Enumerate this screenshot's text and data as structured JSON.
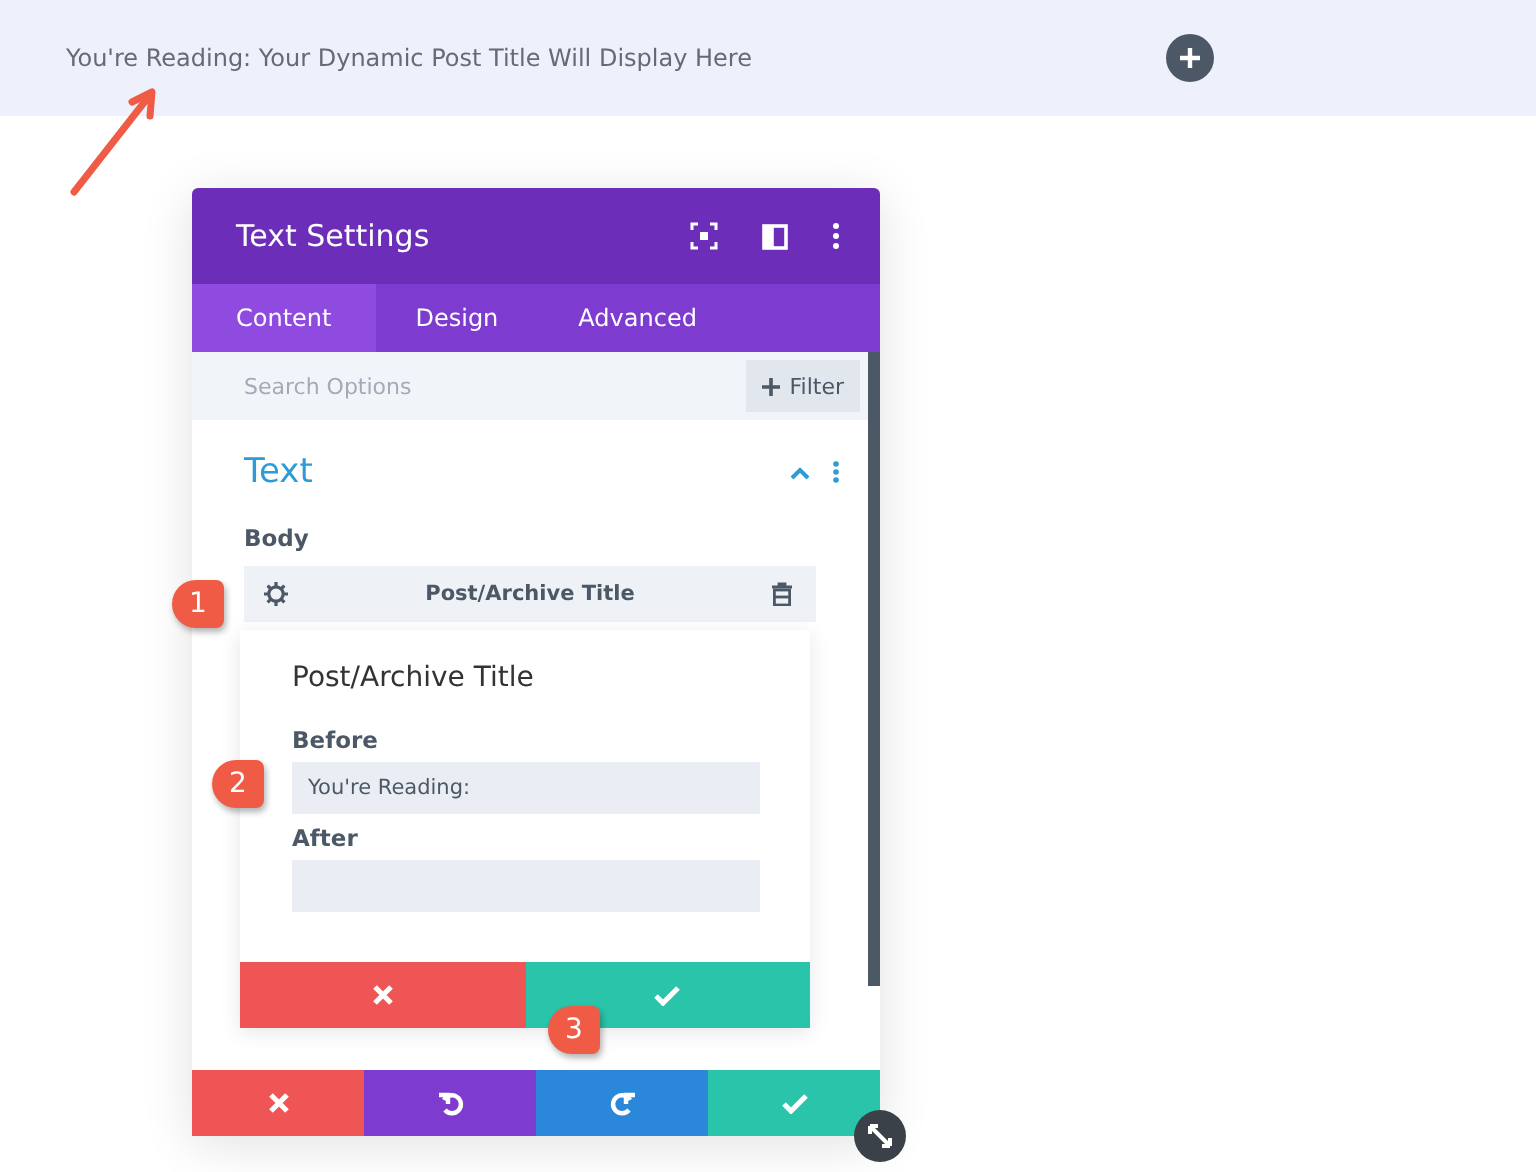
{
  "preview": {
    "text": "You're Reading: Your Dynamic Post Title Will Display Here"
  },
  "modal": {
    "title": "Text Settings",
    "tabs": [
      {
        "label": "Content",
        "selected": true
      },
      {
        "label": "Design",
        "selected": false
      },
      {
        "label": "Advanced",
        "selected": false
      }
    ],
    "search": {
      "placeholder": "Search Options"
    },
    "filter_button": "Filter",
    "section": {
      "title": "Text",
      "expanded": true
    },
    "body_label": "Body",
    "item": {
      "label": "Post/Archive Title"
    },
    "action_bar": [
      {
        "kind": "cancel"
      },
      {
        "kind": "undo"
      },
      {
        "kind": "redo"
      },
      {
        "kind": "save"
      }
    ]
  },
  "popup": {
    "title": "Post/Archive Title",
    "fields": [
      {
        "label": "Before",
        "value": "You're Reading:"
      },
      {
        "label": "After"
      }
    ],
    "buttons": [
      {
        "kind": "cancel"
      },
      {
        "kind": "confirm"
      }
    ]
  },
  "callouts": [
    "1",
    "2",
    "3"
  ]
}
